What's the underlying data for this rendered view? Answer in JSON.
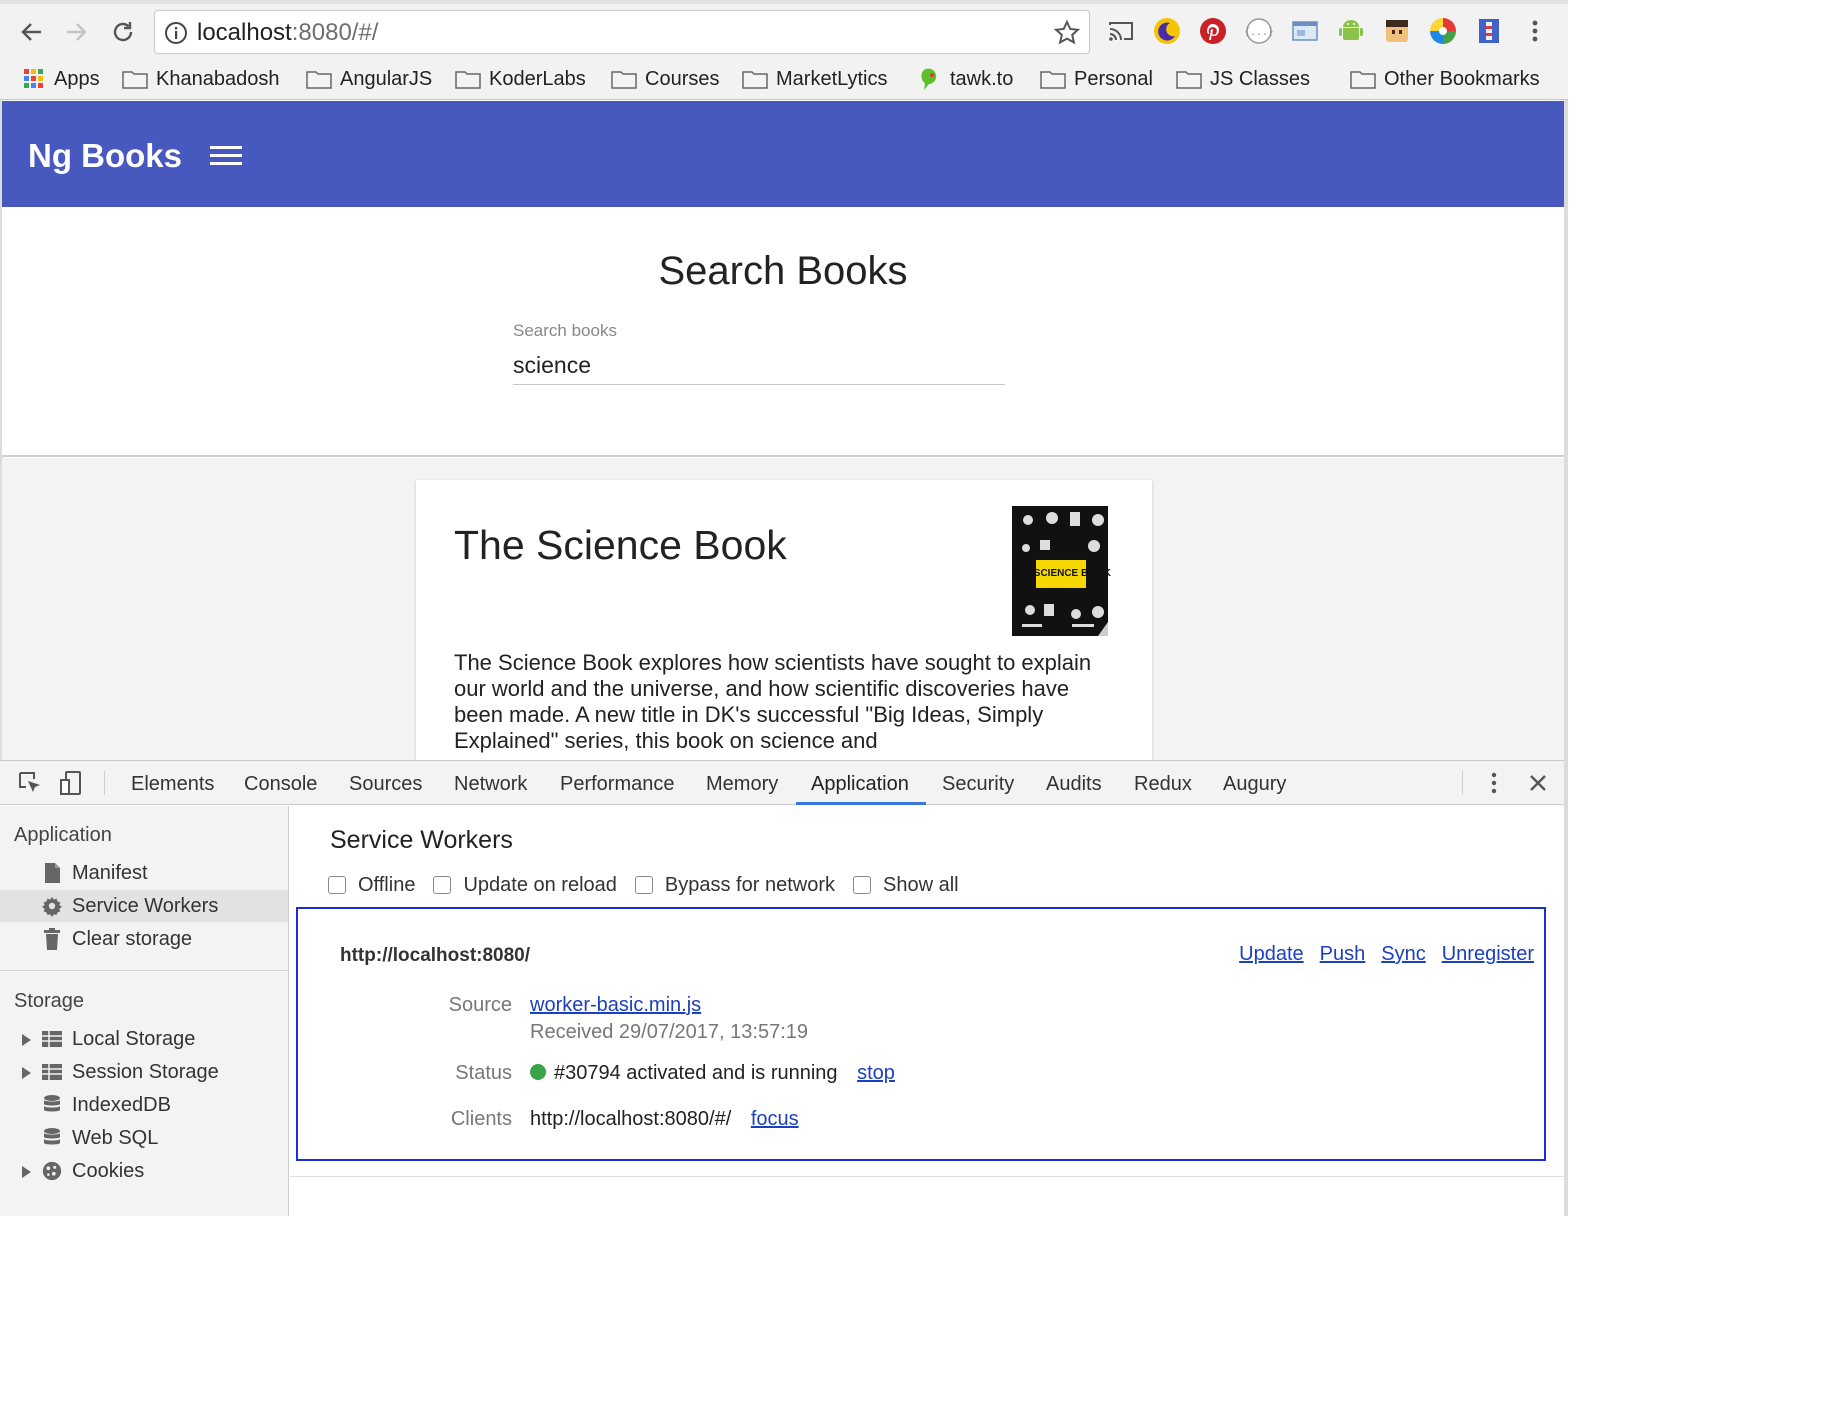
{
  "browser": {
    "url_host": "localhost",
    "url_rest": ":8080/#/",
    "bookmarks": [
      {
        "label": "Apps"
      },
      {
        "label": "Khanabadosh"
      },
      {
        "label": "AngularJS"
      },
      {
        "label": "KoderLabs"
      },
      {
        "label": "Courses"
      },
      {
        "label": "MarketLytics"
      },
      {
        "label": "tawk.to"
      },
      {
        "label": "Personal"
      },
      {
        "label": "JS Classes"
      },
      {
        "label": "Other Bookmarks"
      }
    ]
  },
  "app": {
    "brand": "Ng Books",
    "brand_color": "#4759bf",
    "search": {
      "heading": "Search Books",
      "label": "Search books",
      "value": "science"
    },
    "book": {
      "title": "The Science Book",
      "cover_text": "THE SCIENCE BOOK",
      "description": "The Science Book explores how scientists have sought to explain our world and the universe, and how scientific discoveries have been made. A new title in DK's successful \"Big Ideas, Simply Explained\" series, this book on science and"
    }
  },
  "devtools": {
    "tabs": [
      {
        "label": "Elements"
      },
      {
        "label": "Console"
      },
      {
        "label": "Sources"
      },
      {
        "label": "Network"
      },
      {
        "label": "Performance"
      },
      {
        "label": "Memory"
      },
      {
        "label": "Application",
        "active": true
      },
      {
        "label": "Security"
      },
      {
        "label": "Audits"
      },
      {
        "label": "Redux"
      },
      {
        "label": "Augury"
      }
    ],
    "sidebar": {
      "application_heading": "Application",
      "application_items": [
        {
          "label": "Manifest"
        },
        {
          "label": "Service Workers",
          "selected": true
        },
        {
          "label": "Clear storage"
        }
      ],
      "storage_heading": "Storage",
      "storage_items": [
        {
          "label": "Local Storage"
        },
        {
          "label": "Session Storage"
        },
        {
          "label": "IndexedDB"
        },
        {
          "label": "Web SQL"
        },
        {
          "label": "Cookies"
        }
      ]
    },
    "service_workers": {
      "title": "Service Workers",
      "options": [
        {
          "label": "Offline",
          "checked": false
        },
        {
          "label": "Update on reload",
          "checked": false
        },
        {
          "label": "Bypass for network",
          "checked": false
        },
        {
          "label": "Show all",
          "checked": false
        }
      ],
      "scope": "http://localhost:8080/",
      "actions": [
        "Update",
        "Push",
        "Sync",
        "Unregister"
      ],
      "source_label": "Source",
      "source_file": "worker-basic.min.js",
      "received": "Received 29/07/2017, 13:57:19",
      "status_label": "Status",
      "status_text": "#30794 activated and is running",
      "status_color": "#3aa34a",
      "stop_label": "stop",
      "clients_label": "Clients",
      "client_url": "http://localhost:8080/#/",
      "focus_label": "focus"
    }
  }
}
